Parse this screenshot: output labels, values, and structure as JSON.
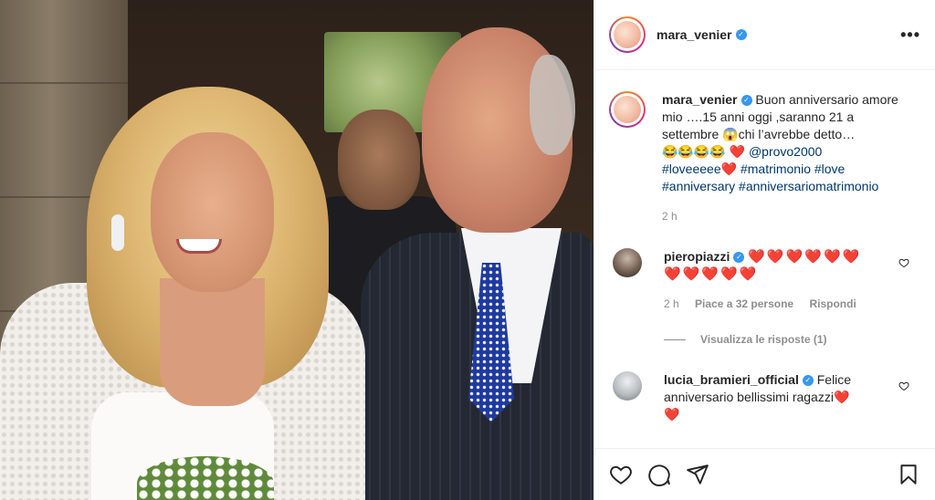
{
  "post": {
    "username": "mara_venier",
    "more_label": "•••"
  },
  "caption": {
    "username": "mara_venier",
    "line1": "Buon anniversario amore mio ….15 anni oggi ,saranno 21 a settembre",
    "line1_emoji": "😱",
    "line1_tail": "chi l’avrebbe detto…",
    "laugh_emojis": "😂😂😂😂",
    "heart": "❤️",
    "mention": "@provo2000",
    "tag1": "#loveeeee",
    "tag1_heart": "❤️",
    "tag2": "#matrimonio",
    "tag3": "#love",
    "tag4": "#anniversary",
    "tag5": "#anniversariomatrimonio",
    "time": "2 h"
  },
  "comments": [
    {
      "username": "pieropiazzi",
      "hearts_line1": "❤️❤️❤️❤️❤️❤️",
      "hearts_line2": "❤️❤️❤️❤️❤️",
      "time": "2 h",
      "likes": "Piace a 32 persone",
      "reply": "Rispondi"
    },
    {
      "username": "lucia_bramieri_official",
      "text": "Felice anniversario bellissimi ragazzi",
      "heart": "❤️",
      "heart2": "❤️"
    }
  ],
  "view_replies": "Visualizza le risposte (1)",
  "icons": {
    "like": "heart-icon",
    "comment": "comment-icon",
    "share": "share-icon",
    "save": "bookmark-icon",
    "comment_like": "small-heart-icon"
  },
  "colors": {
    "link": "#00376b",
    "muted": "#8e8e8e",
    "verified": "#3897f0",
    "heart": "#ed1c24"
  }
}
